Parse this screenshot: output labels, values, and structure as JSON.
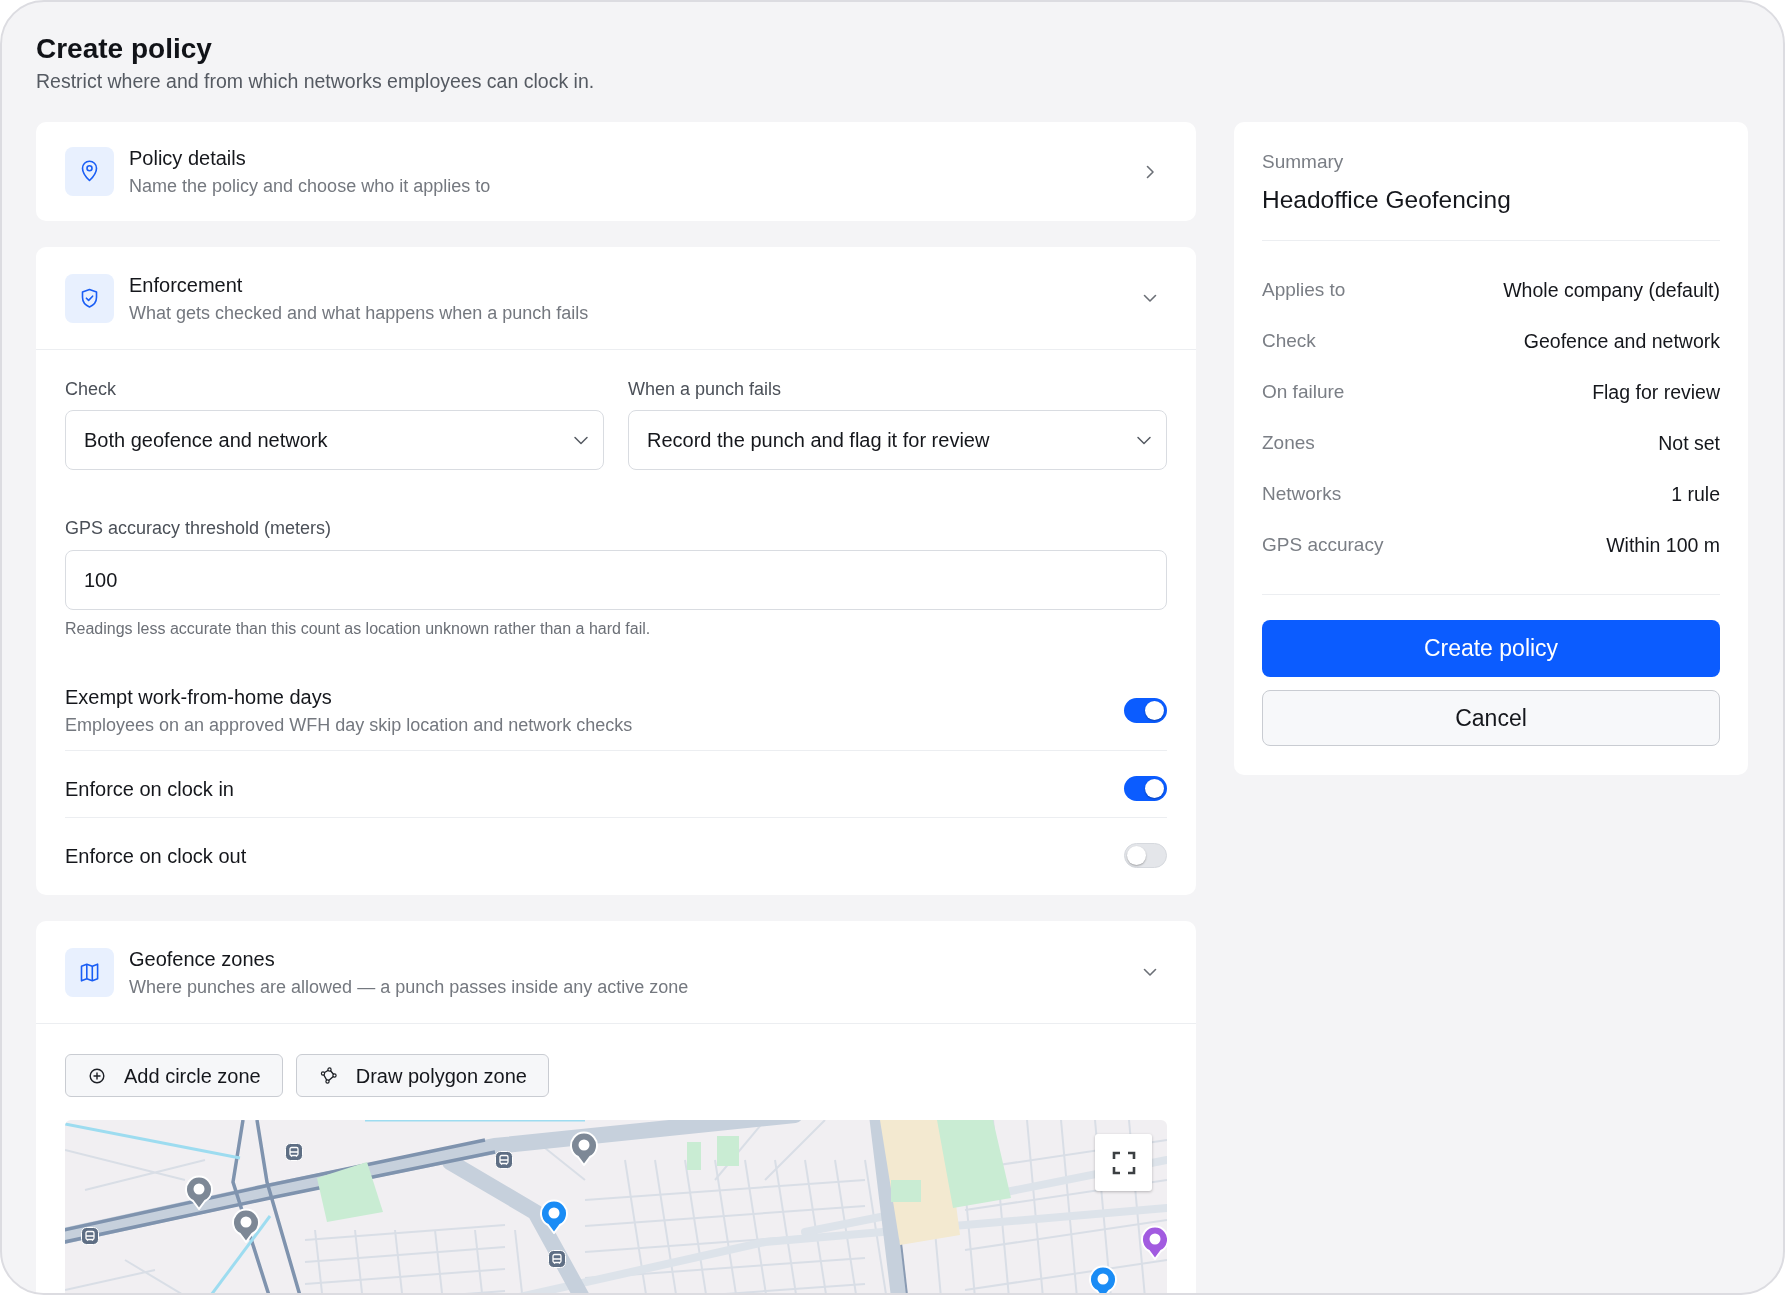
{
  "header": {
    "title": "Create policy",
    "subtitle": "Restrict where and from which networks employees can clock in."
  },
  "sections": [
    {
      "kind": "details",
      "title": "Policy details",
      "subtitle": "Name the policy and choose who it applies to",
      "expanded": false
    },
    {
      "kind": "enforcement",
      "title": "Enforcement",
      "subtitle": "What gets checked and what happens when a punch fails",
      "expanded": true,
      "selects": [
        {
          "label": "Check",
          "value": "Both geofence and network"
        },
        {
          "label": "When a punch fails",
          "value": "Record the punch and flag it for review"
        }
      ],
      "threshold": {
        "label": "GPS accuracy threshold (meters)",
        "value": "100",
        "hint": "Readings less accurate than this count as location unknown rather than a hard fail."
      },
      "toggles": [
        {
          "label": "Exempt work-from-home days",
          "description": "Employees on an approved WFH day skip location and network checks",
          "on": true
        },
        {
          "label": "Enforce on clock in",
          "on": true
        },
        {
          "label": "Enforce on clock out",
          "on": false
        }
      ]
    },
    {
      "kind": "zones",
      "title": "Geofence zones",
      "subtitle": "Where punches are allowed — a punch passes inside any active zone",
      "expanded": true,
      "buttons": [
        {
          "kind": "circle",
          "label": "Add circle zone"
        },
        {
          "kind": "polygon",
          "label": "Draw polygon zone"
        }
      ]
    }
  ],
  "summary": {
    "heading": "Summary",
    "title": "Headoffice Geofencing",
    "rows": [
      {
        "label": "Applies to",
        "value": "Whole company (default)"
      },
      {
        "label": "Check",
        "value": "Geofence and network"
      },
      {
        "label": "On failure",
        "value": "Flag for review"
      },
      {
        "label": "Zones",
        "value": "Not set"
      },
      {
        "label": "Networks",
        "value": "1 rule"
      },
      {
        "label": "GPS accuracy",
        "value": "Within 100 m"
      }
    ],
    "actions": [
      {
        "kind": "primary",
        "label": "Create policy"
      },
      {
        "kind": "secondary",
        "label": "Cancel"
      }
    ]
  }
}
